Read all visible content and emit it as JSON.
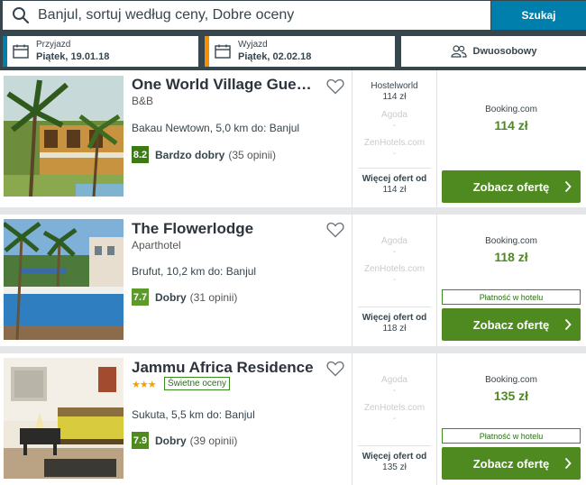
{
  "search": {
    "query": "Banjul, sortuj według ceny, Dobre oceny",
    "button": "Szukaj"
  },
  "dates": {
    "checkin_label": "Przyjazd",
    "checkin_value": "Piątek, 19.01.18",
    "checkout_label": "Wyjazd",
    "checkout_value": "Piątek, 02.02.18"
  },
  "room": {
    "label": "Dwuosobowy"
  },
  "colors": {
    "accent": "#007fad",
    "checkout": "#f48f00",
    "cta": "#4e8a1f",
    "score": "#4e8a1f"
  },
  "results": [
    {
      "name": "One World Village Guest…",
      "type": "B&B",
      "location": "Bakau Newtown, 5,0 km do: Banjul",
      "score": "8.2",
      "rating_text": "Bardzo dobry",
      "reviews": "(35 opinii)",
      "partners": [
        {
          "name": "Hostelworld",
          "price": "114 zł"
        },
        {
          "name": "Agoda",
          "price": "-"
        },
        {
          "name": "ZenHotels.com",
          "price": "-"
        }
      ],
      "more_label": "Więcej ofert od",
      "more_price": "114 zł",
      "deal_site": "Booking.com",
      "deal_price": "114 zł",
      "cta": "Zobacz ofertę"
    },
    {
      "name": "The Flowerlodge",
      "type": "Aparthotel",
      "location": "Brufut, 10,2 km do: Banjul",
      "score": "7.7",
      "rating_text": "Dobry",
      "reviews": "(31 opinii)",
      "partners": [
        {
          "name": "Agoda",
          "price": "-"
        },
        {
          "name": "ZenHotels.com",
          "price": "-"
        }
      ],
      "more_label": "Więcej ofert od",
      "more_price": "118 zł",
      "deal_site": "Booking.com",
      "deal_price": "118 zł",
      "pay_at_hotel": "Płatność w hotelu",
      "cta": "Zobacz ofertę"
    },
    {
      "name": "Jammu Africa Residence",
      "stars": "★★★",
      "badge": "Świetne oceny",
      "location": "Sukuta, 5,5 km do: Banjul",
      "score": "7.9",
      "rating_text": "Dobry",
      "reviews": "(39 opinii)",
      "partners": [
        {
          "name": "Agoda",
          "price": "-"
        },
        {
          "name": "ZenHotels.com",
          "price": "-"
        }
      ],
      "more_label": "Więcej ofert od",
      "more_price": "135 zł",
      "deal_site": "Booking.com",
      "deal_price": "135 zł",
      "pay_at_hotel": "Płatność w hotelu",
      "cta": "Zobacz ofertę"
    }
  ]
}
